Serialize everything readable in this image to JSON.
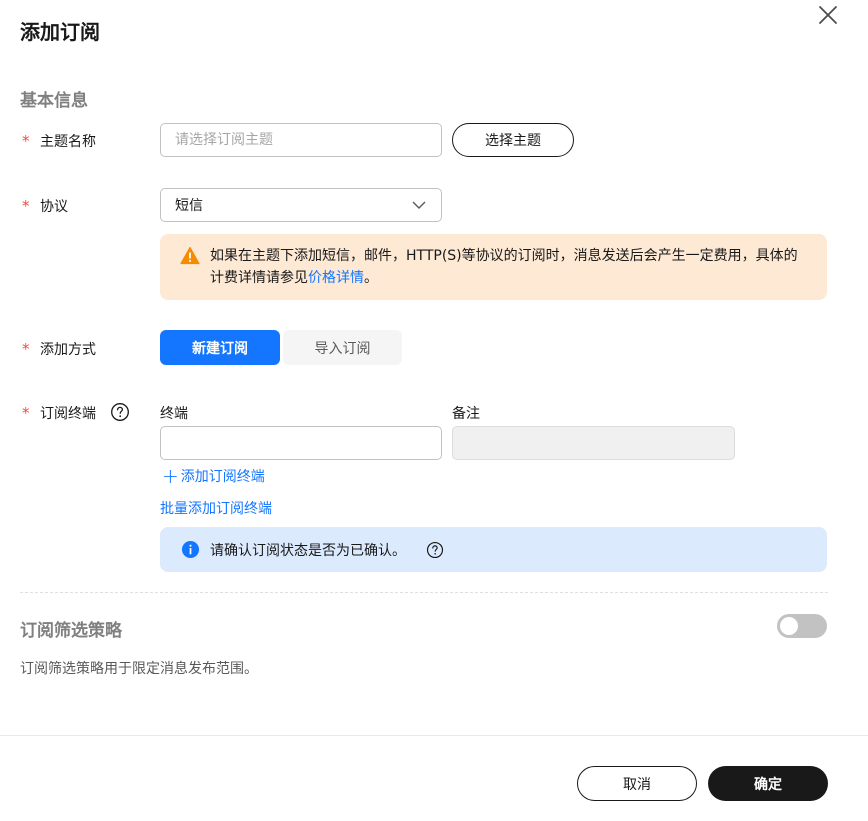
{
  "dialog": {
    "title": "添加订阅",
    "close_icon": "close-icon"
  },
  "basic_info": {
    "section_title": "基本信息",
    "required_mark": "*",
    "topic": {
      "label": "主题名称",
      "placeholder": "请选择订阅主题",
      "value": "",
      "select_button": "选择主题"
    },
    "protocol": {
      "label": "协议",
      "selected": "短信",
      "dropdown_icon": "chevron-down-icon"
    },
    "warning": {
      "icon": "warning-triangle-icon",
      "text_main": "如果在主题下添加短信，邮件，HTTP(S)等协议的订阅时，消息发送后会产生一定费用，具体的计费详情请参见",
      "link": "价格详情",
      "text_end": "。",
      "color": "#fde9d4"
    },
    "add_method": {
      "label": "添加方式",
      "options": [
        "新建订阅",
        "导入订阅"
      ],
      "active": "新建订阅",
      "active_color": "#1476ff"
    },
    "endpoint": {
      "label": "订阅终端",
      "help_icon": "question-circle-icon",
      "col_endpoint": "终端",
      "col_remark": "备注",
      "endpoint_value": "",
      "add_link": "添加订阅终端",
      "add_link_icon": "plus-icon",
      "batch_link": "批量添加订阅终端"
    },
    "info": {
      "icon": "info-circle-icon",
      "text": "请确认订阅状态是否为已确认。",
      "help_icon": "question-circle-icon",
      "color": "#dbeafd"
    }
  },
  "filter_policy": {
    "section_title": "订阅筛选策略",
    "enabled": false,
    "description": "订阅筛选策略用于限定消息发布范围。"
  },
  "footer": {
    "cancel": "取消",
    "confirm": "确定"
  }
}
